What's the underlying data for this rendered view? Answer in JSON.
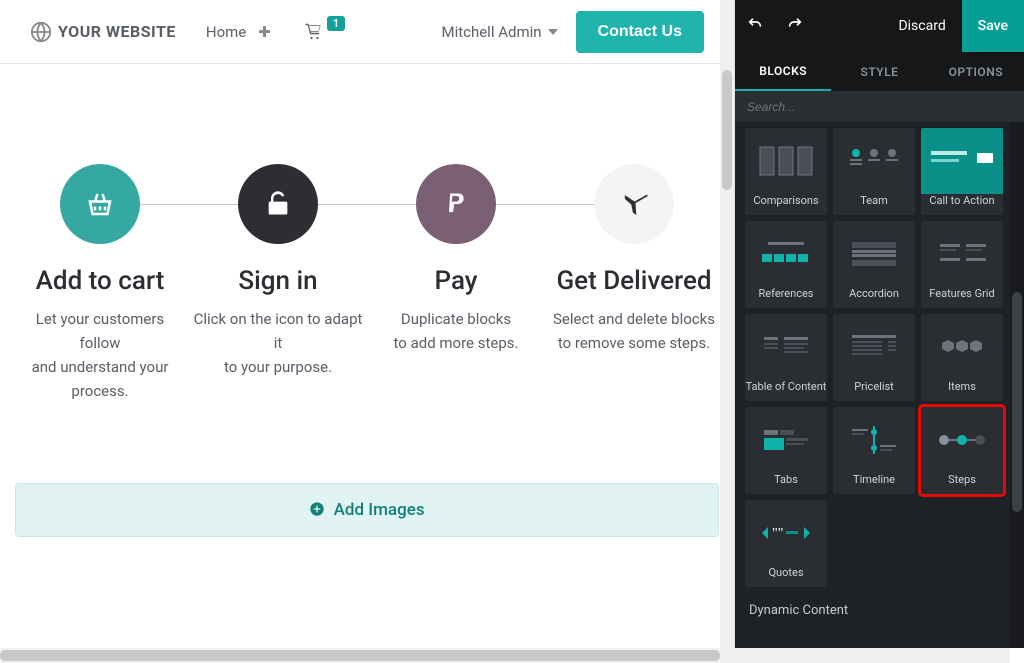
{
  "brand": "YOUR WEBSITE",
  "nav": {
    "home": "Home",
    "cart_count": "1",
    "user": "Mitchell Admin",
    "contact": "Contact Us"
  },
  "steps": [
    {
      "title": "Add to cart",
      "desc": "Let your customers follow\nand understand your process."
    },
    {
      "title": "Sign in",
      "desc": "Click on the icon to adapt it\nto your purpose."
    },
    {
      "title": "Pay",
      "desc": "Duplicate blocks\nto add more steps."
    },
    {
      "title": "Get Delivered",
      "desc": "Select and delete blocks\nto remove some steps."
    }
  ],
  "add_images": "Add Images",
  "panel": {
    "discard": "Discard",
    "save": "Save",
    "tabs": {
      "blocks": "BLOCKS",
      "style": "STYLE",
      "options": "OPTIONS"
    },
    "search_placeholder": "Search...",
    "dynamic_header": "Dynamic Content"
  },
  "blocks": {
    "comparisons": "Comparisons",
    "team": "Team",
    "cta": "Call to Action",
    "references": "References",
    "accordion": "Accordion",
    "features": "Features Grid",
    "toc": "Table of Content",
    "pricelist": "Pricelist",
    "items": "Items",
    "tabs": "Tabs",
    "timeline": "Timeline",
    "steps": "Steps",
    "quotes": "Quotes"
  }
}
